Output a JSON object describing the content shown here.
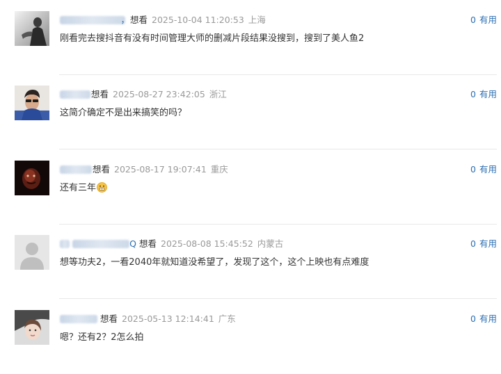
{
  "comments": [
    {
      "user_visible": "，",
      "status": "想看",
      "time": "2025-10-04 11:20:53",
      "location": "上海",
      "content": "刚看完去搜抖音有没有时间管理大师的删减片段结果没搜到，搜到了美人鱼2",
      "useful_count": "0",
      "useful_label": "有用"
    },
    {
      "user_visible": "",
      "status": "想看",
      "time": "2025-08-27 23:42:05",
      "location": "浙江",
      "content": "这简介确定不是出来搞笑的吗？",
      "useful_count": "0",
      "useful_label": "有用"
    },
    {
      "user_visible": "",
      "status": "想看",
      "time": "2025-08-17 19:07:41",
      "location": "重庆",
      "content": "还有三年",
      "useful_count": "0",
      "useful_label": "有用"
    },
    {
      "user_visible": "Q",
      "status": "想看",
      "time": "2025-08-08 15:45:52",
      "location": "内蒙古",
      "content": "想等功夫2，一看2040年就知道没希望了，发现了这个，这个上映也有点难度",
      "useful_count": "0",
      "useful_label": "有用"
    },
    {
      "user_visible": "",
      "status": "想看",
      "time": "2025-05-13 12:14:41",
      "location": "广东",
      "content": "嗯？还有2？2怎么拍",
      "useful_count": "0",
      "useful_label": "有用"
    }
  ]
}
